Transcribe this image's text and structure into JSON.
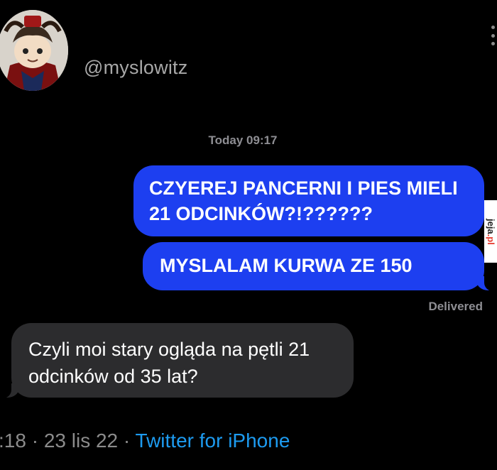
{
  "profile": {
    "handle": "@myslowitz",
    "avatar_icon": "cartoon-character-avatar-icon"
  },
  "conversation": {
    "timestamp_day": "Today",
    "timestamp_time": "09:17",
    "sent_messages": [
      "CZYEREJ PANCERNI I PIES MIELI 21 ODCINKÓW?!??????",
      "MYSLALAM KURWA ZE 150"
    ],
    "delivery_status": "Delivered",
    "received_messages": [
      "Czyli moi stary ogląda na pętli 21 odcinków od 35 lat?"
    ]
  },
  "tweet_meta": {
    "time_fragment": ":18",
    "separator1": " · ",
    "date": "23 lis 22",
    "separator2": " · ",
    "source": "Twitter for iPhone"
  },
  "watermark": {
    "text_main": "jeja",
    "text_accent": ".pl"
  },
  "colors": {
    "background": "#000000",
    "sent_bubble": "#1d3ff0",
    "received_bubble": "#2c2c2e",
    "link": "#1d9bf0"
  }
}
